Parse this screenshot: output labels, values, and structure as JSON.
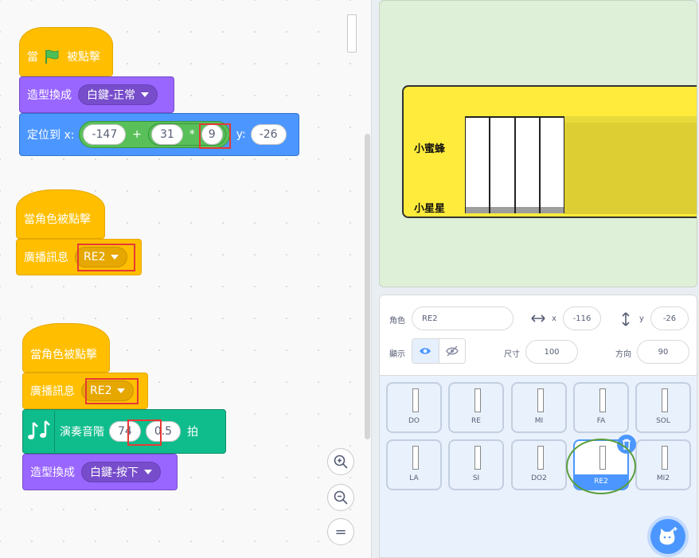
{
  "colors": {
    "events": "#ffbf00",
    "looks": "#9966ff",
    "motion": "#4c97ff",
    "music": "#0fbd8c",
    "operators": "#59c059",
    "highlight_red": "#e53935",
    "highlight_green": "#5a9e3a"
  },
  "script1": {
    "hat_prefix": "當",
    "hat_suffix": "被點擊",
    "costume_label": "造型換成",
    "costume_value": "白鍵-正常",
    "goto_label": "定位到 x:",
    "x_base": "-147",
    "op_plus": "+",
    "multiplier": "31",
    "op_times": "*",
    "index": "9",
    "y_label": "y:",
    "y_value": "-26"
  },
  "script2": {
    "hat": "當角色被點擊",
    "broadcast_label": "廣播訊息",
    "broadcast_value": "RE2"
  },
  "script3": {
    "hat": "當角色被點擊",
    "broadcast_label": "廣播訊息",
    "broadcast_value": "RE2",
    "play_label": "演奏音階",
    "note": "74",
    "beats": "0.5",
    "beats_unit": "拍",
    "costume_label": "造型換成",
    "costume_value": "白鍵-按下"
  },
  "zoom": {
    "in_icon": "zoom-in-icon",
    "out_icon": "zoom-out-icon",
    "reset_label": "="
  },
  "stage": {
    "label_top": "小蜜蜂",
    "label_bottom": "小星星"
  },
  "sprite_info": {
    "sprite_label": "角色",
    "sprite_name": "RE2",
    "x_label": "x",
    "x_value": "-116",
    "y_label": "y",
    "y_value": "-26",
    "show_label": "顯示",
    "size_label": "尺寸",
    "size_value": "100",
    "direction_label": "方向",
    "direction_value": "90"
  },
  "sprites": {
    "row1": [
      "DO",
      "RE",
      "MI",
      "FA",
      "SOL"
    ],
    "row2": [
      "LA",
      "SI",
      "DO2",
      "RE2",
      "MI2"
    ],
    "selected": "RE2"
  }
}
